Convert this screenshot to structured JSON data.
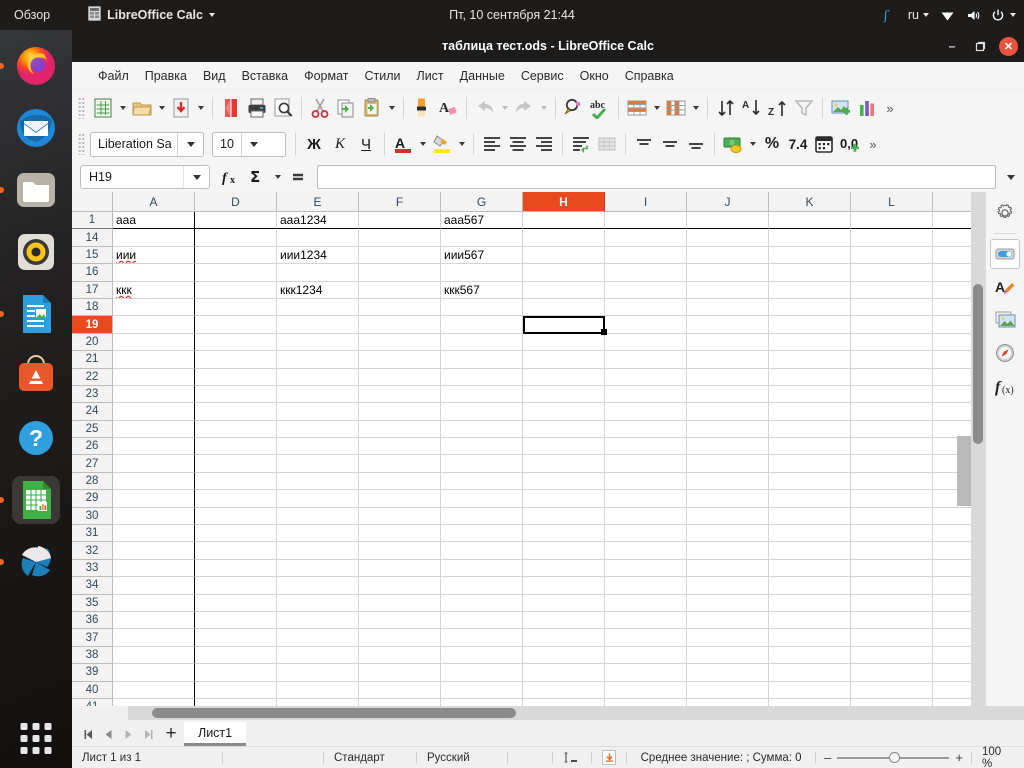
{
  "topbar": {
    "activities": "Обзор",
    "app_name": "LibreOffice Calc",
    "clock": "Пт, 10 сентября  21:44",
    "keyboard_layout": "ru",
    "icons": [
      "dropbox-icon",
      "network-icon",
      "volume-icon",
      "power-icon"
    ]
  },
  "dock": {
    "items": [
      {
        "name": "firefox",
        "running": true
      },
      {
        "name": "thunderbird",
        "running": false
      },
      {
        "name": "files",
        "running": true
      },
      {
        "name": "rhythmbox",
        "running": false
      },
      {
        "name": "libreoffice-writer",
        "running": true
      },
      {
        "name": "ubuntu-software",
        "running": false
      },
      {
        "name": "help",
        "running": false
      },
      {
        "name": "libreoffice-calc",
        "running": true,
        "active": true
      },
      {
        "name": "photos",
        "running": true
      }
    ],
    "show_apps": "show-applications"
  },
  "window": {
    "title": "таблица тест.ods - LibreOffice Calc",
    "minimize": "–",
    "maximize": "❐",
    "close": "✕"
  },
  "menubar": {
    "items": [
      "Файл",
      "Правка",
      "Вид",
      "Вставка",
      "Формат",
      "Стили",
      "Лист",
      "Данные",
      "Сервис",
      "Окно",
      "Справка"
    ]
  },
  "standard_toolbar": {
    "items": [
      "new-document-icon",
      "new-dropdown",
      "open-icon",
      "open-dropdown",
      "save-icon",
      "save-dropdown",
      "export-pdf-icon",
      "print-icon",
      "print-preview-icon",
      "cut-icon",
      "copy-icon",
      "paste-icon",
      "paste-dropdown",
      "clone-formatting-icon",
      "clear-formatting-icon",
      "undo-icon",
      "undo-dropdown",
      "redo-icon",
      "redo-dropdown",
      "find-replace-icon",
      "spelling-icon",
      "row-icon",
      "row-dropdown",
      "column-icon",
      "column-dropdown",
      "sort-icon",
      "sort-ascending-icon",
      "sort-descending-icon",
      "autofilter-icon",
      "insert-image-icon",
      "insert-chart-icon",
      "overflow-icon"
    ]
  },
  "formatting_toolbar": {
    "font_name": "Liberation Sa",
    "font_size": "10",
    "bold": "Ж",
    "italic": "K",
    "underline": "Ч",
    "font_color": "A",
    "highlight_color": "highlighting-color-icon",
    "items": [
      "align-left-icon",
      "align-center-icon",
      "align-right-icon",
      "wrap-text-icon",
      "merge-cells-icon",
      "align-top-icon",
      "align-center-vertical-icon",
      "align-bottom-icon",
      "currency-icon",
      "currency-dropdown",
      "percent-icon",
      "number-format-icon",
      "date-icon",
      "add-decimal-icon",
      "overflow-icon"
    ]
  },
  "formula_bar": {
    "name_box": "H19",
    "function_wizard": "fx",
    "sum": "Σ",
    "formula": "=",
    "input_line": "",
    "input_placeholder": "",
    "expand_icon": "chevron-down-icon"
  },
  "sheet": {
    "columns": [
      "A",
      "D",
      "E",
      "F",
      "G",
      "H",
      "I",
      "J",
      "K",
      "L"
    ],
    "selected_column": "H",
    "rows": [
      "1",
      "14",
      "15",
      "16",
      "17",
      "18",
      "19",
      "20",
      "21",
      "22",
      "23",
      "24",
      "25",
      "26",
      "27",
      "28",
      "29",
      "30",
      "31",
      "32",
      "33",
      "34",
      "35",
      "36",
      "37",
      "38",
      "39",
      "40",
      "41"
    ],
    "selected_row": "19",
    "page_break_after_row": "1",
    "cells": [
      {
        "row": "1",
        "A": "aaa",
        "D": "",
        "E": "aaa1234",
        "F": "",
        "G": "aaa567"
      },
      {
        "row": "14",
        "A": "",
        "D": "",
        "E": "",
        "F": "",
        "G": ""
      },
      {
        "row": "15",
        "A": "иии",
        "D": "",
        "E": "иии1234",
        "F": "",
        "G": "иии567",
        "misspelled": true
      },
      {
        "row": "16",
        "A": "",
        "D": "",
        "E": "",
        "F": "",
        "G": ""
      },
      {
        "row": "17",
        "A": "ккк",
        "D": "",
        "E": "ккк1234",
        "F": "",
        "G": "ккк567",
        "misspelled": true
      },
      {
        "row": "18",
        "A": "",
        "D": "",
        "E": "",
        "F": "",
        "G": ""
      },
      {
        "row": "19",
        "A": "",
        "D": "",
        "E": "",
        "F": "",
        "G": ""
      }
    ],
    "selected_cell": "H19"
  },
  "sidebar": {
    "items": [
      {
        "name": "sidebar-settings",
        "icon": "gear-icon"
      },
      {
        "name": "sidebar-properties",
        "icon": "properties-icon"
      },
      {
        "name": "sidebar-styles",
        "icon": "styles-icon"
      },
      {
        "name": "sidebar-gallery",
        "icon": "gallery-icon"
      },
      {
        "name": "sidebar-navigator",
        "icon": "navigator-icon"
      },
      {
        "name": "sidebar-functions",
        "icon": "functions-icon"
      }
    ],
    "functions_label": "f(x)"
  },
  "tabbar": {
    "first": "first-sheet-icon",
    "prev": "previous-sheet-icon",
    "next": "next-sheet-icon",
    "last": "last-sheet-icon",
    "add": "+",
    "sheets": [
      "Лист1"
    ],
    "active_sheet": "Лист1"
  },
  "statusbar": {
    "sheet_count": "Лист 1 из 1",
    "page_style": "Стандарт",
    "language": "Русский",
    "insert_mode": "insert-mode-icon",
    "selection_mode": "selection-mode-icon",
    "modified": "document-modified-icon",
    "summary": "Среднее значение: ; Сумма: 0",
    "zoom_minus": "–",
    "zoom_plus": "+",
    "zoom_level": "100 %"
  }
}
